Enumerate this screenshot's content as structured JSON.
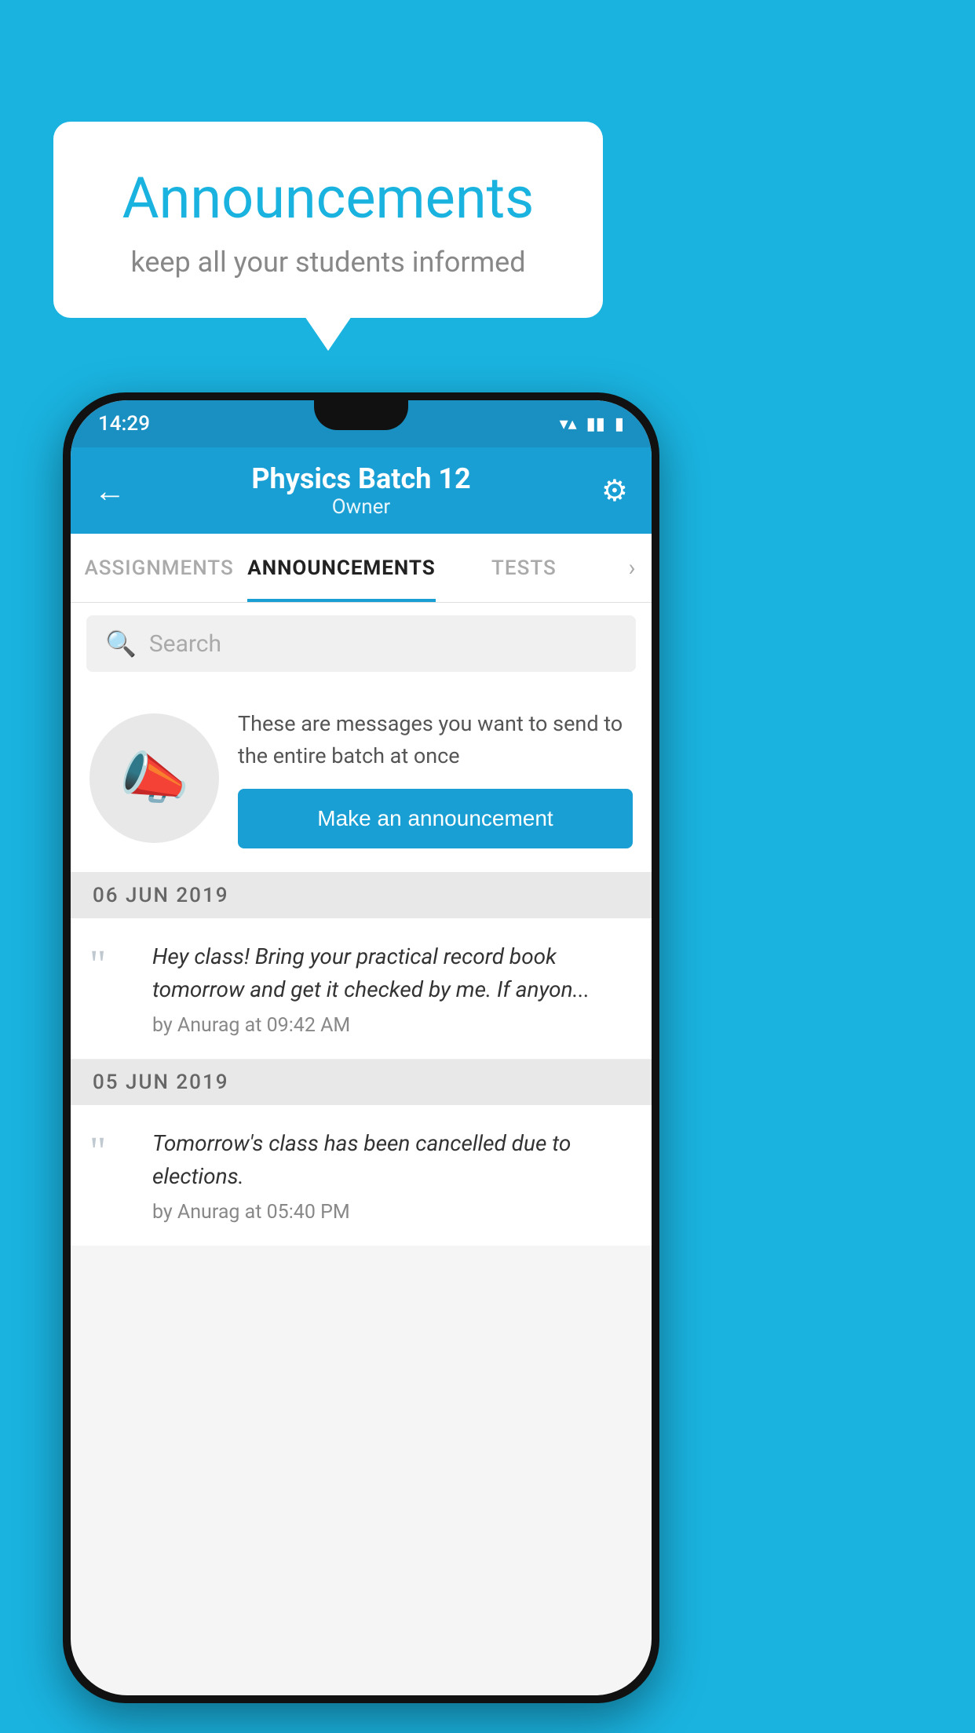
{
  "page": {
    "background_color": "#1ab3e0"
  },
  "speech_bubble": {
    "title": "Announcements",
    "subtitle": "keep all your students informed"
  },
  "status_bar": {
    "time": "14:29",
    "wifi_icon": "▼",
    "signal_icon": "▲",
    "battery_icon": "▮"
  },
  "app_bar": {
    "back_icon": "←",
    "title": "Physics Batch 12",
    "subtitle": "Owner",
    "gear_icon": "⚙"
  },
  "tabs": {
    "items": [
      {
        "label": "ASSIGNMENTS",
        "active": false
      },
      {
        "label": "ANNOUNCEMENTS",
        "active": true
      },
      {
        "label": "TESTS",
        "active": false
      }
    ],
    "more_icon": "›"
  },
  "search": {
    "placeholder": "Search",
    "search_icon": "🔍"
  },
  "promo": {
    "description": "These are messages you want to send to the entire batch at once",
    "button_label": "Make an announcement"
  },
  "announcements": [
    {
      "date": "06  JUN  2019",
      "text": "Hey class! Bring your practical record book tomorrow and get it checked by me. If anyon...",
      "meta": "by Anurag at 09:42 AM"
    },
    {
      "date": "05  JUN  2019",
      "text": "Tomorrow's class has been cancelled due to elections.",
      "meta": "by Anurag at 05:40 PM"
    }
  ]
}
